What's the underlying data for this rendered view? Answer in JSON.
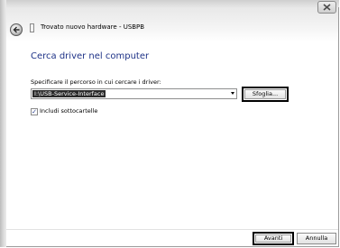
{
  "window": {
    "title": "Trovato nuovo hardware - USBPB",
    "close_icon": "close-icon",
    "back_icon": "back-arrow-icon",
    "hardware_icon": "hardware-device-icon"
  },
  "page": {
    "heading": "Cerca driver nel computer",
    "path_label": "Specificare il percorso in cui cercare i driver:",
    "path_value": "I:\\USB-Service-Interface",
    "browse_label": "Sfoglia...",
    "include_subfolders_label": "Includi sottocartelle",
    "include_subfolders_checked": true
  },
  "footer": {
    "next_label": "Avanti",
    "cancel_label": "Annulla"
  },
  "colors": {
    "heading": "#1e3287",
    "highlight": "#2a2a2a"
  }
}
